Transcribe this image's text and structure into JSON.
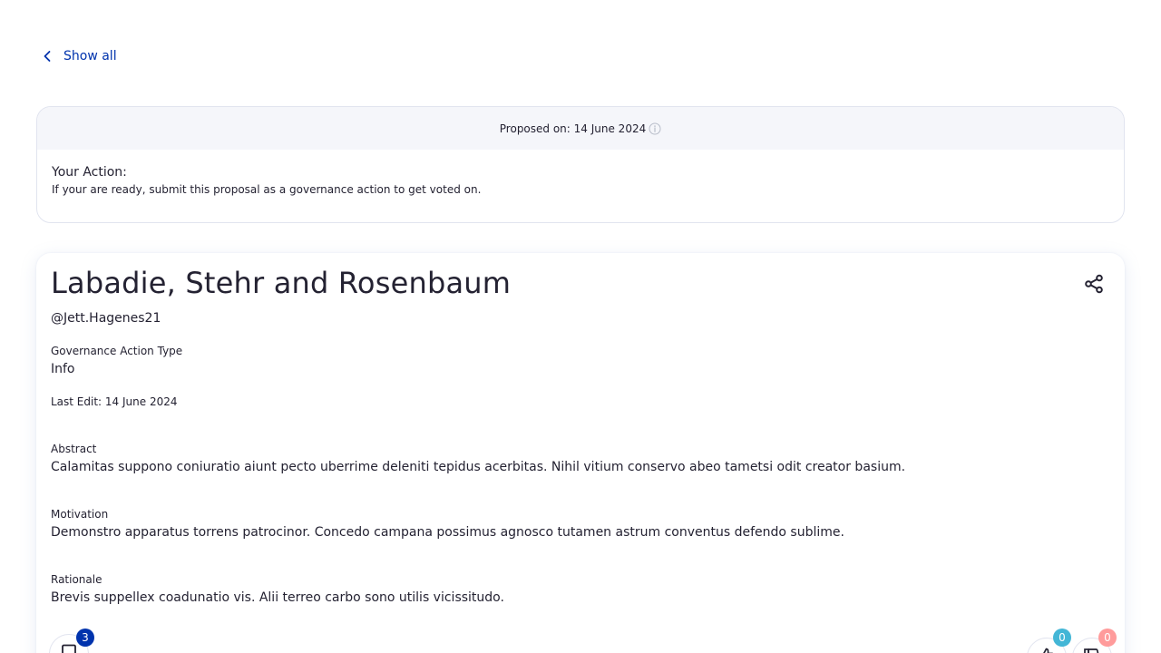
{
  "nav": {
    "back_label": "Show all"
  },
  "action_card": {
    "proposed_on": "Proposed on: 14 June 2024",
    "title": "Your Action:",
    "description": "If your are ready, submit this proposal as a governance action to get voted on."
  },
  "proposal": {
    "title": "Labadie, Stehr and Rosenbaum",
    "author": "@Jett.Hagenes21",
    "governance_action_type_label": "Governance Action Type",
    "governance_action_type_value": "Info",
    "last_edit": "Last Edit: 14 June 2024",
    "abstract_label": "Abstract",
    "abstract_value": "Calamitas suppono coniuratio aiunt pecto uberrime deleniti tepidus acerbitas. Nihil vitium conservo abeo tametsi odit creator basium.",
    "motivation_label": "Motivation",
    "motivation_value": "Demonstro apparatus torrens patrocinor. Concedo campana possimus agnosco tutamen astrum conventus defendo sublime.",
    "rationale_label": "Rationale",
    "rationale_value": "Brevis suppellex coadunatio vis. Alii terreo carbo sono utilis vicissitudo."
  },
  "counters": {
    "comments": "3",
    "likes": "0",
    "dislikes": "0"
  },
  "colors": {
    "primary": "#0033ad",
    "text": "#242232",
    "like_badge": "#43b6d6",
    "dislike_badge": "#ff9b9b",
    "muted_bg": "#f5f6fa",
    "border": "#e1e4ef"
  },
  "icons": {
    "back": "chevron-left-icon",
    "info": "info-icon",
    "share": "share-icon",
    "comments": "comment-icon",
    "like": "thumbs-up-icon",
    "dislike": "thumbs-down-icon"
  }
}
